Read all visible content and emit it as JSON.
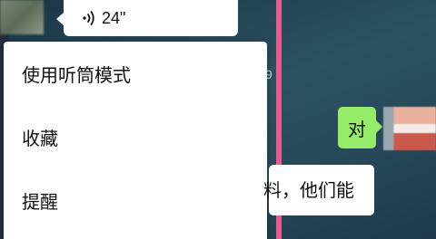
{
  "voice_message": {
    "icon": "voice-wave-icon",
    "duration": "24\""
  },
  "context_menu": {
    "items": [
      {
        "label": "使用听筒模式"
      },
      {
        "label": "收藏"
      },
      {
        "label": "提醒"
      }
    ]
  },
  "background_chat": {
    "peek_text": "9",
    "outgoing_message": "对",
    "incoming_partial": "料，他们能"
  },
  "colors": {
    "accent_line": "#ea5a8c",
    "outgoing_bubble": "#95ec69",
    "menu_background": "#ffffff"
  }
}
